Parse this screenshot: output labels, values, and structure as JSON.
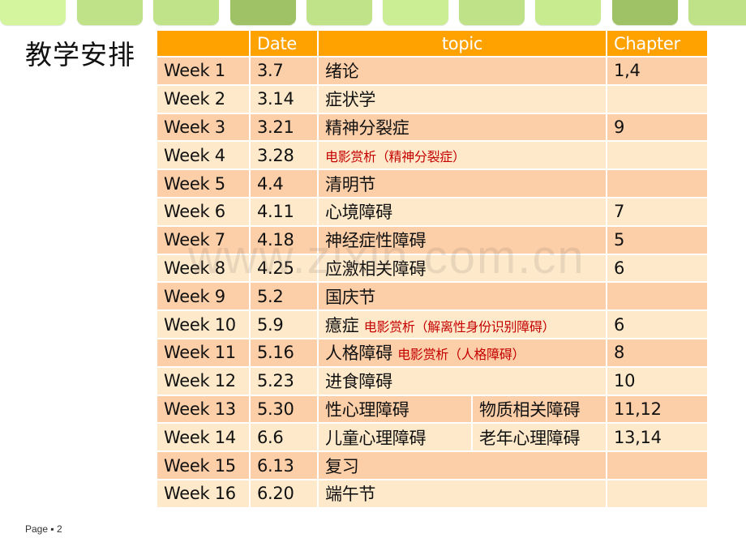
{
  "slide": {
    "title": "教学安排",
    "page_label": "Page ▪ 2",
    "watermark": "www.zixin.com.cn"
  },
  "colors": {
    "header_bg": "#ffa200",
    "row_dark": "#fdcfa8",
    "row_light": "#feeacb",
    "holiday_text": "#1f74c4",
    "film_text": "#c40000",
    "tabs": [
      "#d4f59d",
      "#bfe187",
      "#c0e289",
      "#a0c266",
      "#c0e289",
      "#cbed93",
      "#bfe187",
      "#c8eb8f",
      "#a0c266",
      "#bfe187"
    ]
  },
  "table": {
    "headers": {
      "week": "",
      "date": "Date",
      "topic": "topic",
      "chapter": "Chapter"
    },
    "rows": [
      {
        "week": "Week 1",
        "date": "3.7",
        "topic": "绪论",
        "film": "",
        "topic2": "",
        "chapter": "1,4",
        "holiday": false
      },
      {
        "week": "Week 2",
        "date": "3.14",
        "topic": "症状学",
        "film": "",
        "topic2": "",
        "chapter": "",
        "holiday": false
      },
      {
        "week": "Week 3",
        "date": "3.21",
        "topic": "精神分裂症",
        "film": "",
        "topic2": "",
        "chapter": "9",
        "holiday": false
      },
      {
        "week": "Week 4",
        "date": "3.28",
        "topic": "",
        "film": "电影赏析（精神分裂症）",
        "topic2": "",
        "chapter": "",
        "holiday": false
      },
      {
        "week": "Week 5",
        "date": "4.4",
        "topic": "清明节",
        "film": "",
        "topic2": "",
        "chapter": "",
        "holiday": true
      },
      {
        "week": "Week 6",
        "date": "4.11",
        "topic": "心境障碍",
        "film": "",
        "topic2": "",
        "chapter": "7",
        "holiday": false
      },
      {
        "week": "Week 7",
        "date": "4.18",
        "topic": "神经症性障碍",
        "film": "",
        "topic2": "",
        "chapter": "5",
        "holiday": false
      },
      {
        "week": "Week 8",
        "date": "4.25",
        "topic": "应激相关障碍",
        "film": "",
        "topic2": "",
        "chapter": "6",
        "holiday": false
      },
      {
        "week": "Week 9",
        "date": "5.2",
        "topic": "国庆节",
        "film": "",
        "topic2": "",
        "chapter": "",
        "holiday": true
      },
      {
        "week": "Week 10",
        "date": "5.9",
        "topic": "癔症",
        "film": "电影赏析（解离性身份识别障碍）",
        "topic2": "",
        "chapter": "6",
        "holiday": false
      },
      {
        "week": "Week 11",
        "date": "5.16",
        "topic": "人格障碍",
        "film": "电影赏析（人格障碍）",
        "topic2": "",
        "chapter": "8",
        "holiday": false
      },
      {
        "week": "Week 12",
        "date": "5.23",
        "topic": "进食障碍",
        "film": "",
        "topic2": "",
        "chapter": "10",
        "holiday": false
      },
      {
        "week": "Week 13",
        "date": "5.30",
        "topic": "性心理障碍",
        "film": "",
        "topic2": "物质相关障碍",
        "chapter": "11,12",
        "holiday": false
      },
      {
        "week": "Week 14",
        "date": "6.6",
        "topic": "儿童心理障碍",
        "film": "",
        "topic2": "老年心理障碍",
        "chapter": "13,14",
        "holiday": false
      },
      {
        "week": "Week 15",
        "date": "6.13",
        "topic": "复习",
        "film": "",
        "topic2": "",
        "chapter": "",
        "holiday": false
      },
      {
        "week": "Week 16",
        "date": "6.20",
        "topic": "端午节",
        "film": "",
        "topic2": "",
        "chapter": "",
        "holiday": true
      }
    ]
  }
}
